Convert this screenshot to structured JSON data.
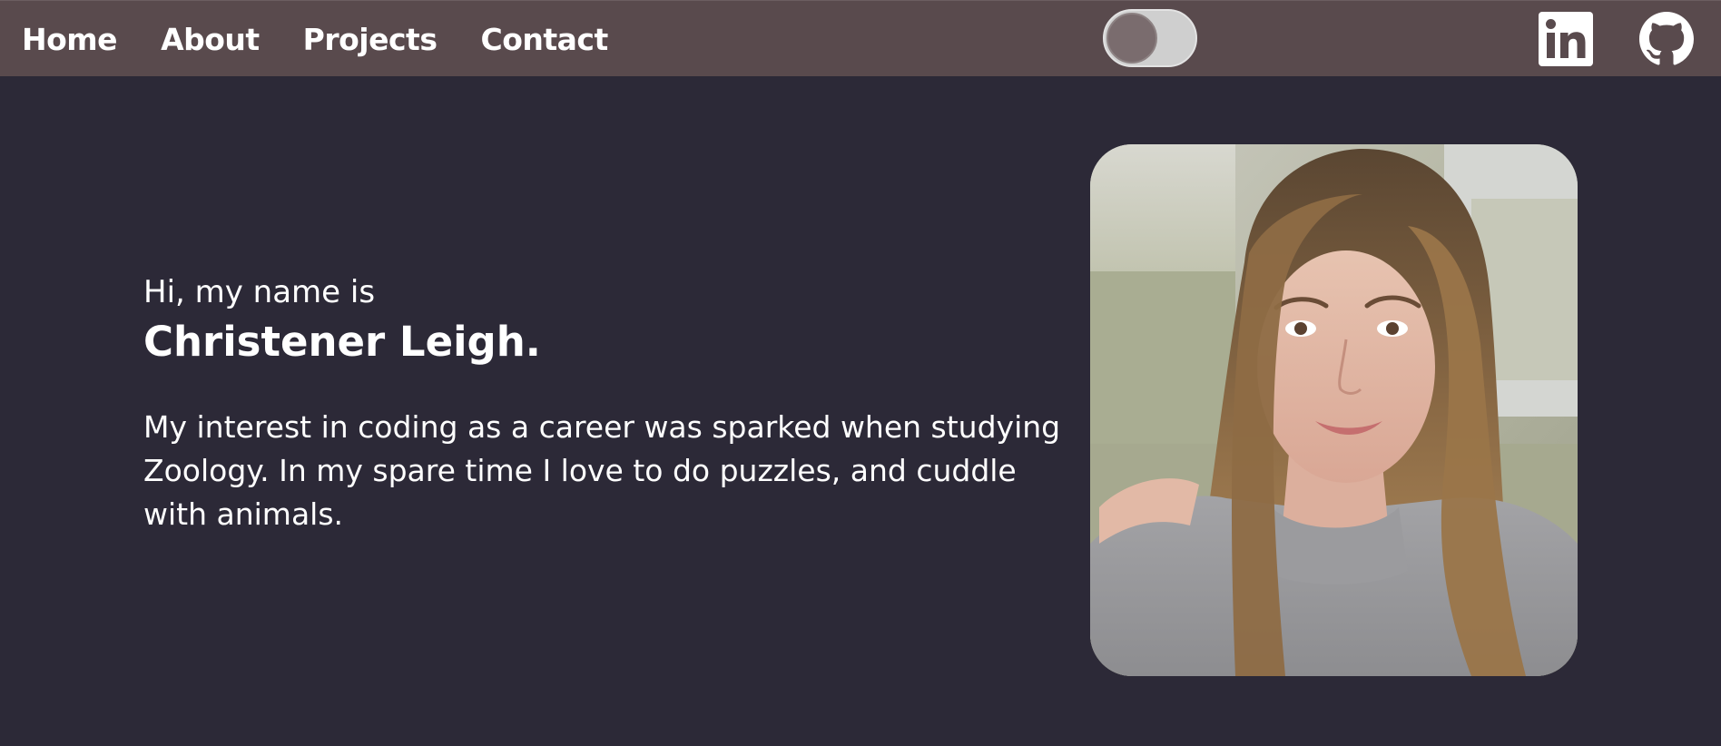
{
  "nav": {
    "links": [
      "Home",
      "About",
      "Projects",
      "Contact"
    ],
    "theme_toggle_state": "off",
    "social": [
      "linkedin-icon",
      "github-icon"
    ]
  },
  "hero": {
    "greeting": "Hi, my name is",
    "name": "Christener Leigh.",
    "bio": "My interest in coding as a career was sparked when studying Zoology. In my spare time I love to do puzzles, and cuddle with animals."
  },
  "colors": {
    "navbar_bg": "#594a4d",
    "page_bg": "#2c2937",
    "text": "#ffffff",
    "toggle_track": "#cfcfcf",
    "toggle_knob": "#7a6c6e"
  }
}
